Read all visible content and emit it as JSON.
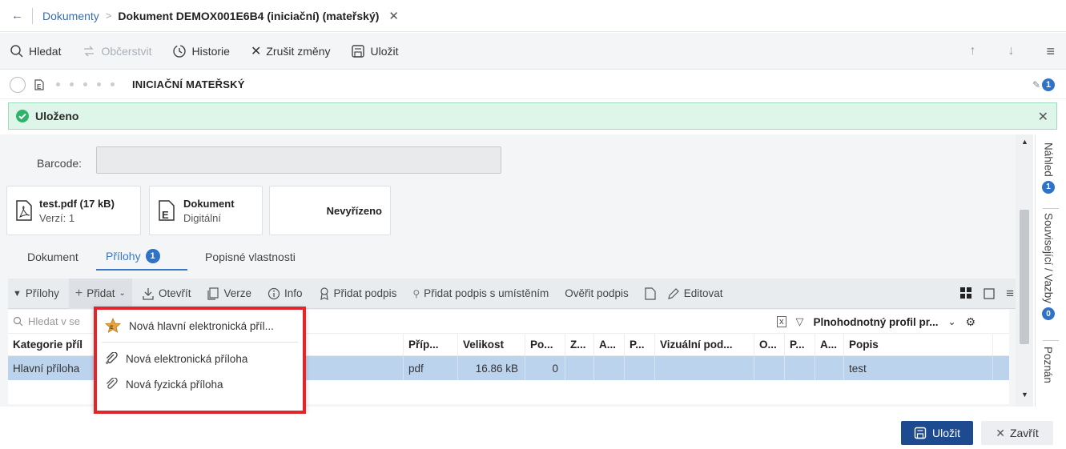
{
  "breadcrumb": {
    "link": "Dokumenty",
    "separator": ">",
    "current": "Dokument DEMOX001E6B4 (iniciační) (mateřský)"
  },
  "toolbar": {
    "search": "Hledat",
    "refresh": "Občerstvit",
    "history": "Historie",
    "cancel": "Zrušit změny",
    "save": "Uložit"
  },
  "status": {
    "title": "INICIAČNÍ MATEŘSKÝ",
    "attachment_count": "1"
  },
  "banner": {
    "text": "Uloženo"
  },
  "form": {
    "barcode_label": "Barcode:",
    "barcode_value": ""
  },
  "cards": {
    "file": {
      "name": "test.pdf (17 kB)",
      "version": "Verzí: 1"
    },
    "doc": {
      "title": "Dokument",
      "subtitle": "Digitální"
    },
    "state": {
      "title": "Nevyřízeno"
    }
  },
  "tabs": {
    "document": "Dokument",
    "attachments": "Přílohy",
    "attachments_count": "1",
    "properties": "Popisné vlastnosti"
  },
  "attach_toolbar": {
    "section": "Přílohy",
    "add": "Přidat",
    "open": "Otevřít",
    "versions": "Verze",
    "info": "Info",
    "add_signature": "Přidat podpis",
    "add_signature_placed": "Přidat podpis s umístěním",
    "verify_signature": "Ověřit podpis",
    "edit": "Editovat"
  },
  "grid": {
    "search_placeholder": "Hledat v se",
    "profile": "Plnohodnotný profil pr...",
    "columns": [
      "Kategorie příl",
      "Příp...",
      "Velikost",
      "Po...",
      "Z...",
      "A...",
      "P...",
      "Vizuální pod...",
      "O...",
      "P...",
      "A...",
      "Popis"
    ],
    "rows": [
      [
        "Hlavní příloha",
        "pdf",
        "16.86 kB",
        "0",
        "",
        "",
        "",
        "",
        "",
        "",
        "",
        "test"
      ]
    ]
  },
  "dropdown": {
    "items": [
      "Nová hlavní elektronická příl...",
      "Nová elektronická příloha",
      "Nová fyzická příloha"
    ]
  },
  "sidepanel": {
    "preview": "Náhled",
    "preview_count": "1",
    "related": "Související / Vazby",
    "related_count": "0",
    "notes": "Poznán"
  },
  "footer": {
    "save": "Uložit",
    "close": "Zavřít"
  },
  "colors": {
    "accent": "#3a78c5",
    "primary_button": "#1e4b8f",
    "success_bg": "#def5ea",
    "highlight_border": "#e0262b",
    "selected_row": "#bcd3ee"
  }
}
